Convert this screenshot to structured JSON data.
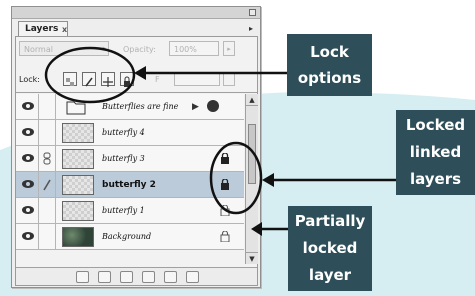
{
  "palette": {
    "tab_label": "Layers",
    "tab_close": "x",
    "menu_arrow": "▸",
    "blend_mode": "Normal",
    "opacity_label": "Opacity:",
    "opacity_value": "100%",
    "lock_label": "Lock:",
    "fill_label": "F",
    "layers": [
      {
        "name": "Butterflies are fine",
        "style": "set",
        "linked": false,
        "selected": false,
        "lock": "none"
      },
      {
        "name": "butterfly 4",
        "style": "normal",
        "linked": false,
        "selected": false,
        "lock": "none"
      },
      {
        "name": "butterfly 3",
        "style": "normal",
        "linked": true,
        "selected": false,
        "lock": "full"
      },
      {
        "name": "butterfly 2",
        "style": "bold",
        "linked": true,
        "selected": true,
        "lock": "full"
      },
      {
        "name": "butterfly 1",
        "style": "normal",
        "linked": false,
        "selected": false,
        "lock": "partial"
      },
      {
        "name": "Background",
        "style": "normal",
        "linked": false,
        "selected": false,
        "lock": "partial"
      }
    ]
  },
  "callouts": {
    "lock_options": [
      "Lock",
      "options"
    ],
    "locked_linked": [
      "Locked",
      "linked",
      "layers"
    ],
    "partially_locked": [
      "Partially",
      "locked",
      "layer"
    ]
  },
  "colors": {
    "callout_bg": "#2e4f59",
    "selected_row": "#bccbd9",
    "background_shape": "#d6eef2"
  }
}
